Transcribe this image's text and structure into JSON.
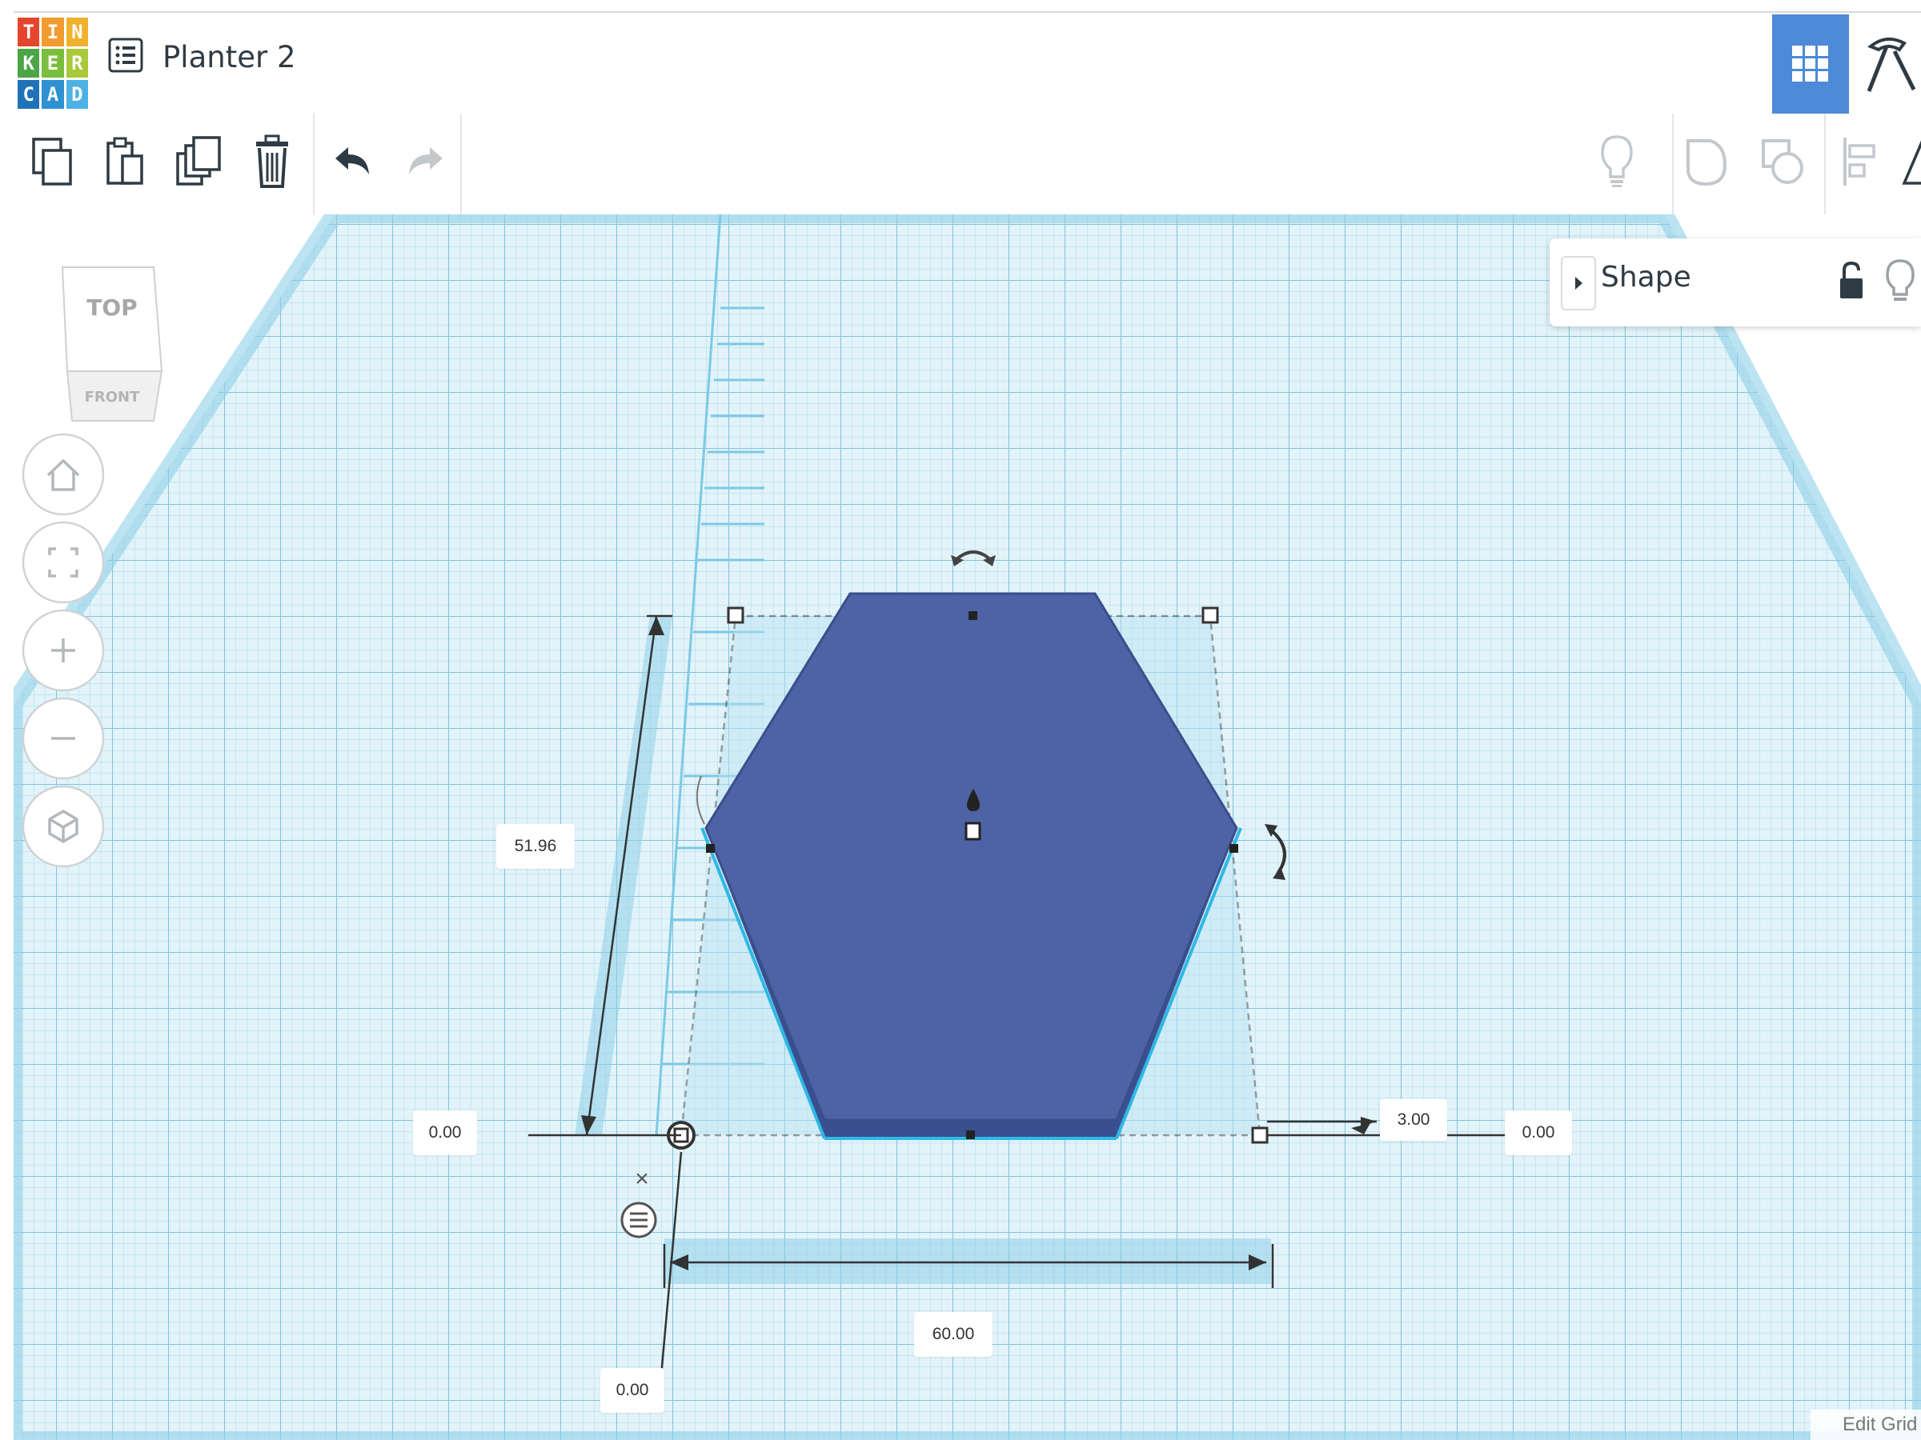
{
  "logo": {
    "letters": [
      "T",
      "I",
      "N",
      "K",
      "E",
      "R",
      "C",
      "A",
      "D"
    ]
  },
  "design": {
    "title": "Planter 2"
  },
  "toolbar": {
    "tools": [
      "copy-icon",
      "paste-icon",
      "duplicate-icon",
      "delete-icon",
      "undo-icon",
      "redo-icon"
    ],
    "right_tools": [
      "show-all-icon",
      "group-icon",
      "ungroup-icon",
      "align-icon",
      "mirror-icon"
    ]
  },
  "header_right": {
    "icons": [
      "grid-view-icon",
      "build-hammer-icon"
    ]
  },
  "viewcube": {
    "top": "TOP",
    "front": "FRONT"
  },
  "view_controls": [
    "home-icon",
    "fit-view-icon",
    "zoom-in-icon",
    "zoom-out-icon",
    "perspective-icon"
  ],
  "inspector": {
    "title": "Shape",
    "icons": [
      "lock-icon",
      "light-bulb-icon"
    ]
  },
  "dimensions": {
    "length": "51.96",
    "width": "60.00",
    "height": "3.00",
    "left_offset": "0.00",
    "right_offset": "0.00",
    "front_offset": "0.00"
  },
  "footer": {
    "edit_grid": "Edit Grid"
  },
  "colors": {
    "shape": "#4e63a5",
    "grid_bg": "#ddf1f8",
    "grid_line": "#9ed4e8",
    "accent": "#4d8ad7"
  }
}
